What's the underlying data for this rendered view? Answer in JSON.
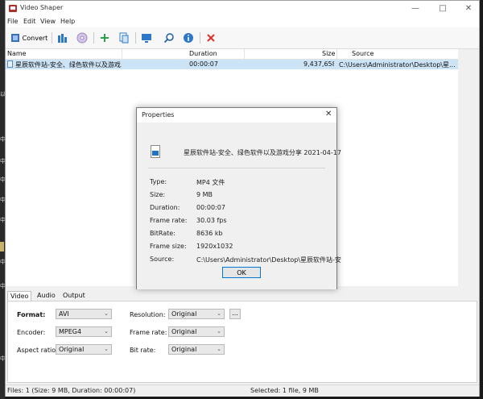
{
  "app": {
    "title": "Video Shaper"
  },
  "menu": [
    "File",
    "Edit",
    "View",
    "Help"
  ],
  "toolbar": {
    "convert_label": "Convert"
  },
  "colors": {
    "accent": "#0078d7",
    "selected_row": "#cde4f7",
    "delete": "#d9342b",
    "add": "#2aa347"
  },
  "desktop": {
    "snippets": [
      "以",
      "中",
      "中",
      "中",
      "中",
      "中",
      "中",
      "中",
      "中"
    ]
  },
  "list": {
    "columns": {
      "name": "Name",
      "duration": "Duration",
      "size": "Size",
      "source": "Source"
    },
    "rows": [
      {
        "name": "星辰软件站-安全、绿色软件以及游戏...",
        "duration": "00:00:07",
        "size": "9,437,658",
        "source": "C:\\Users\\Administrator\\Desktop\\星..."
      }
    ]
  },
  "dialog": {
    "title": "Properties",
    "file_title": "星辰软件站-安全、绿色软件以及游戏分享 2021-04-17",
    "props": [
      {
        "label": "Type:",
        "value": "MP4 文件"
      },
      {
        "label": "Size:",
        "value": "9 MB"
      },
      {
        "label": "Duration:",
        "value": "00:00:07"
      },
      {
        "label": "Frame rate:",
        "value": "30.03 fps"
      },
      {
        "label": "BitRate:",
        "value": "8636 kb"
      },
      {
        "label": "Frame size:",
        "value": "1920x1032"
      },
      {
        "label": "Source:",
        "value": "C:\\Users\\Administrator\\Desktop\\星辰软件站-安"
      }
    ],
    "ok_label": "OK"
  },
  "tabs": [
    "Video",
    "Audio",
    "Output"
  ],
  "settings": {
    "format_label": "Format:",
    "format_value": "AVI",
    "encoder_label": "Encoder:",
    "encoder_value": "MPEG4",
    "aspect_label": "Aspect ratio:",
    "aspect_value": "Original",
    "resolution_label": "Resolution:",
    "resolution_value": "Original",
    "framerate_label": "Frame rate:",
    "framerate_value": "Original",
    "bitrate_label": "Bit rate:",
    "bitrate_value": "Original",
    "dots_label": "..."
  },
  "status": {
    "left": "Files: 1 (Size: 9 MB, Duration: 00:00:07)",
    "right": "Selected: 1 file, 9 MB"
  }
}
